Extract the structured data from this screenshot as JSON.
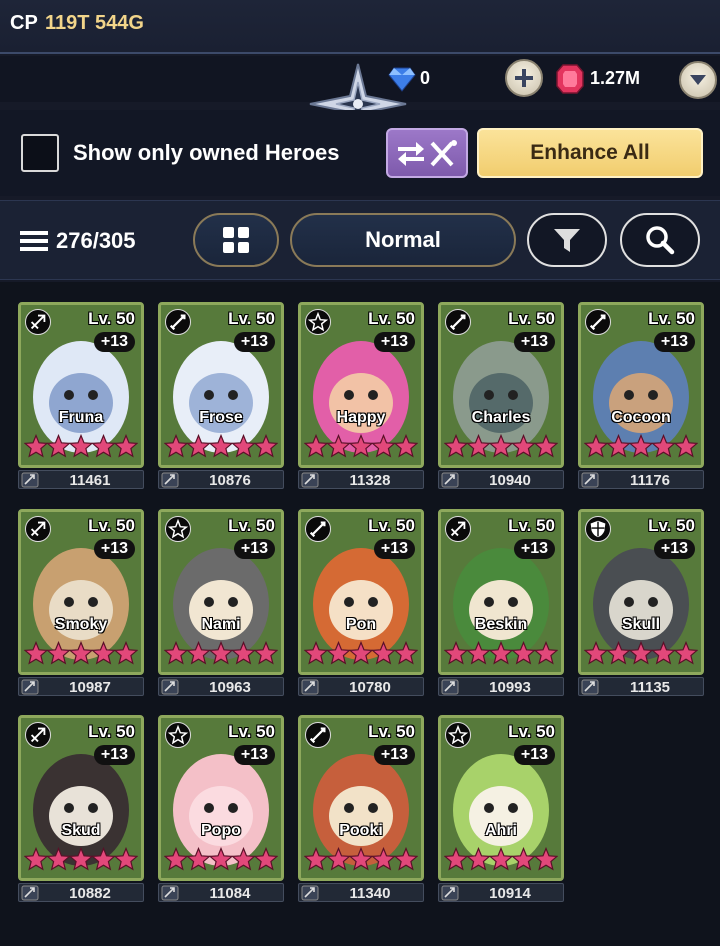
{
  "header": {
    "cp_label": "CP",
    "cp_value": "119T 544G",
    "gems": "0",
    "rubies": "1.27M"
  },
  "filters": {
    "show_owned_label": "Show only owned Heroes",
    "show_owned_checked": false,
    "enhance_all_label": "Enhance All"
  },
  "sort": {
    "count": "276/305",
    "mode": "Normal"
  },
  "colors": {
    "card_border": "#8ea85c",
    "star": "#e2487a",
    "enhance_button": "#f6d77e",
    "swap_button": "#8d68bb"
  },
  "heroes": [
    {
      "name": "Fruna",
      "class_icon": "archer-icon",
      "level": "Lv. 50",
      "plus": "+13",
      "stars": 5,
      "power": "11461"
    },
    {
      "name": "Frose",
      "class_icon": "sword-icon",
      "level": "Lv. 50",
      "plus": "+13",
      "stars": 5,
      "power": "10876"
    },
    {
      "name": "Happy",
      "class_icon": "support-icon",
      "level": "Lv. 50",
      "plus": "+13",
      "stars": 5,
      "power": "11328"
    },
    {
      "name": "Charles",
      "class_icon": "sword-icon",
      "level": "Lv. 50",
      "plus": "+13",
      "stars": 5,
      "power": "10940"
    },
    {
      "name": "Cocoon",
      "class_icon": "sword-icon",
      "level": "Lv. 50",
      "plus": "+13",
      "stars": 5,
      "power": "11176"
    },
    {
      "name": "Smoky",
      "class_icon": "archer-icon",
      "level": "Lv. 50",
      "plus": "+13",
      "stars": 5,
      "power": "10987"
    },
    {
      "name": "Nami",
      "class_icon": "support-icon",
      "level": "Lv. 50",
      "plus": "+13",
      "stars": 5,
      "power": "10963"
    },
    {
      "name": "Pon",
      "class_icon": "sword-icon",
      "level": "Lv. 50",
      "plus": "+13",
      "stars": 5,
      "power": "10780"
    },
    {
      "name": "Beskin",
      "class_icon": "archer-icon",
      "level": "Lv. 50",
      "plus": "+13",
      "stars": 5,
      "power": "10993"
    },
    {
      "name": "Skull",
      "class_icon": "shield-icon",
      "level": "Lv. 50",
      "plus": "+13",
      "stars": 5,
      "power": "11135"
    },
    {
      "name": "Skud",
      "class_icon": "archer-icon",
      "level": "Lv. 50",
      "plus": "+13",
      "stars": 5,
      "power": "10882"
    },
    {
      "name": "Popo",
      "class_icon": "support-icon",
      "level": "Lv. 50",
      "plus": "+13",
      "stars": 5,
      "power": "11084"
    },
    {
      "name": "Pooki",
      "class_icon": "sword-icon",
      "level": "Lv. 50",
      "plus": "+13",
      "stars": 5,
      "power": "11340"
    },
    {
      "name": "Ahri",
      "class_icon": "support-icon",
      "level": "Lv. 50",
      "plus": "+13",
      "stars": 5,
      "power": "10914"
    }
  ]
}
